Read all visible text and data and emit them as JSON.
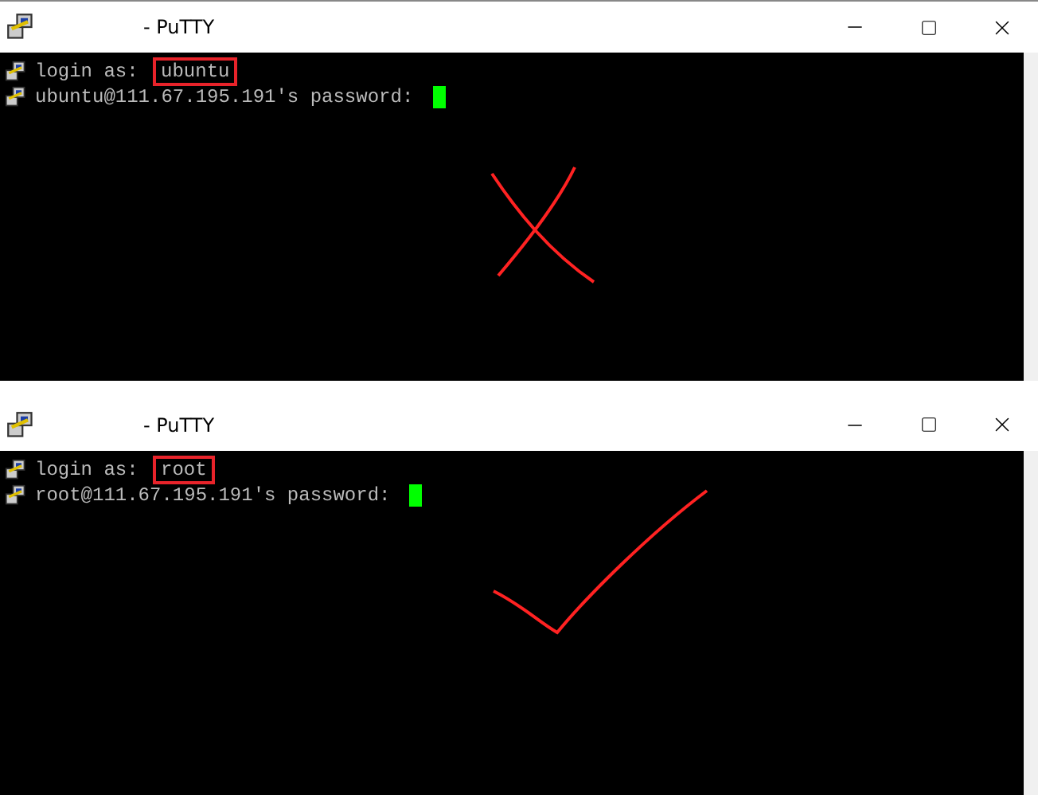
{
  "windows": [
    {
      "title": "- PuTTY",
      "lines": [
        {
          "kind": "login",
          "prompt": "login as: ",
          "value": "ubuntu",
          "highlighted": true
        },
        {
          "kind": "password",
          "prompt": "ubuntu@111.67.195.191's password: ",
          "cursor": true
        }
      ],
      "annotation": {
        "kind": "cross"
      }
    },
    {
      "title": "- PuTTY",
      "lines": [
        {
          "kind": "login",
          "prompt": "login as: ",
          "value": "root",
          "highlighted": true
        },
        {
          "kind": "password",
          "prompt": "root@111.67.195.191's password: ",
          "cursor": true
        }
      ],
      "annotation": {
        "kind": "check"
      }
    }
  ]
}
